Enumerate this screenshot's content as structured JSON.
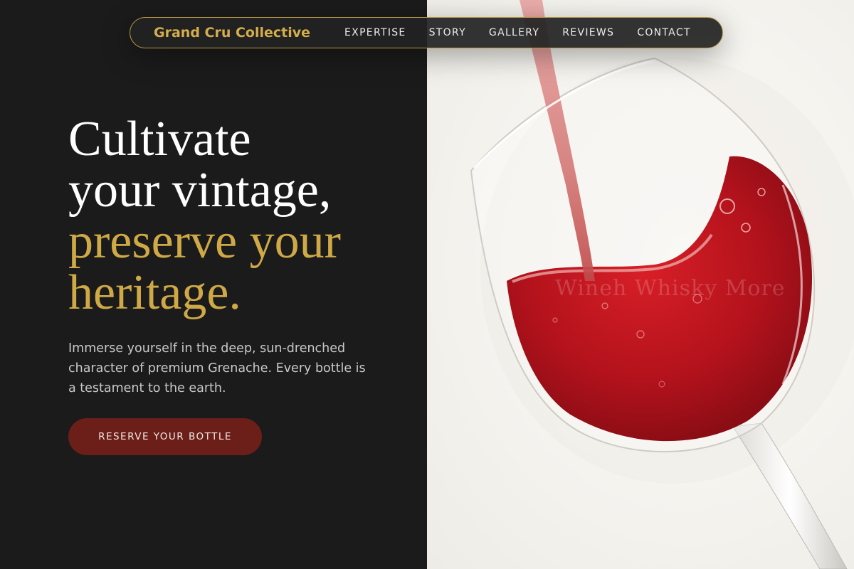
{
  "nav": {
    "brand": "Grand Cru Collective",
    "links": [
      "EXPERTISE",
      "STORY",
      "GALLERY",
      "REVIEWS",
      "CONTACT"
    ]
  },
  "hero": {
    "headline_white": [
      "Cultivate",
      "your vintage,"
    ],
    "headline_gold": [
      "preserve your",
      "heritage."
    ],
    "lead": "Immerse yourself in the deep, sun-drenched character of premium Grenache. Every bottle is a testament to the earth.",
    "cta_label": "RESERVE YOUR BOTTLE"
  },
  "image": {
    "subject": "red-wine-glass-pour",
    "watermark": "Wineh Whisky More"
  },
  "colors": {
    "background": "#1b1b1b",
    "gold": "#cfa946",
    "cta": "#6b1f18",
    "wine": "#b3121c"
  }
}
